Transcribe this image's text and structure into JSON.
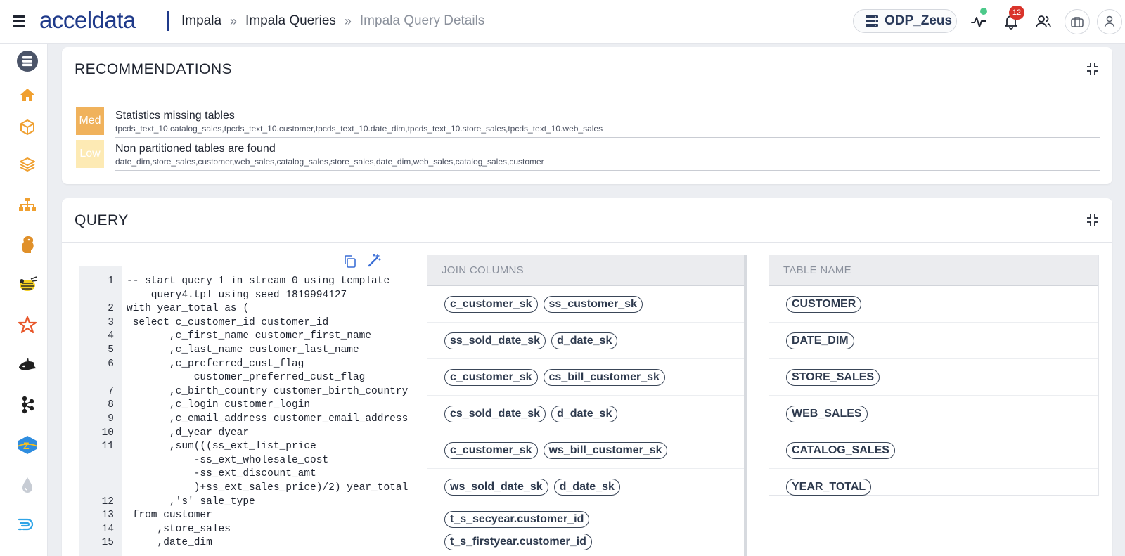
{
  "header": {
    "logo_text": "acceldata",
    "breadcrumb": [
      "Impala",
      "Impala Queries",
      "Impala Query Details"
    ],
    "breadcrumb_sep": "»",
    "cluster_name": "ODP_Zeus",
    "notification_count": "12"
  },
  "sidebar": {
    "items": [
      "database-icon",
      "home-icon",
      "cube-icon",
      "layers-icon",
      "hierarchy-icon",
      "hadoop-icon",
      "hive-icon",
      "spark-icon",
      "orca-icon",
      "kafka-icon",
      "zeppelin-icon",
      "drop-icon",
      "druid-icon"
    ]
  },
  "recommendations": {
    "title": "RECOMMENDATIONS",
    "items": [
      {
        "severity": "Med",
        "title": "Statistics missing tables",
        "detail": "tpcds_text_10.catalog_sales,tpcds_text_10.customer,tpcds_text_10.date_dim,tpcds_text_10.store_sales,tpcds_text_10.web_sales"
      },
      {
        "severity": "Low",
        "title": "Non partitioned tables are found",
        "detail": "date_dim,store_sales,customer,web_sales,catalog_sales,store_sales,date_dim,web_sales,catalog_sales,customer"
      }
    ]
  },
  "query": {
    "title": "QUERY",
    "code_lines": [
      {
        "n": "1",
        "text": "-- start query 1 in stream 0 using template"
      },
      {
        "n": "",
        "text": "    query4.tpl using seed 1819994127"
      },
      {
        "n": "2",
        "text": "with year_total as ("
      },
      {
        "n": "3",
        "text": " select c_customer_id customer_id"
      },
      {
        "n": "4",
        "text": "       ,c_first_name customer_first_name"
      },
      {
        "n": "5",
        "text": "       ,c_last_name customer_last_name"
      },
      {
        "n": "6",
        "text": "       ,c_preferred_cust_flag"
      },
      {
        "n": "",
        "text": "           customer_preferred_cust_flag"
      },
      {
        "n": "7",
        "text": "       ,c_birth_country customer_birth_country"
      },
      {
        "n": "8",
        "text": "       ,c_login customer_login"
      },
      {
        "n": "9",
        "text": "       ,c_email_address customer_email_address"
      },
      {
        "n": "10",
        "text": "       ,d_year dyear"
      },
      {
        "n": "11",
        "text": "       ,sum(((ss_ext_list_price"
      },
      {
        "n": "",
        "text": "           -ss_ext_wholesale_cost"
      },
      {
        "n": "",
        "text": "           -ss_ext_discount_amt"
      },
      {
        "n": "",
        "text": "           )+ss_ext_sales_price)/2) year_total"
      },
      {
        "n": "12",
        "text": "       ,'s' sale_type"
      },
      {
        "n": "13",
        "text": " from customer"
      },
      {
        "n": "14",
        "text": "     ,store_sales"
      },
      {
        "n": "15",
        "text": "     ,date_dim"
      }
    ],
    "join_columns": {
      "header": "JOIN COLUMNS",
      "rows": [
        [
          "c_customer_sk",
          "ss_customer_sk"
        ],
        [
          "ss_sold_date_sk",
          "d_date_sk"
        ],
        [
          "c_customer_sk",
          "cs_bill_customer_sk"
        ],
        [
          "cs_sold_date_sk",
          "d_date_sk"
        ],
        [
          "c_customer_sk",
          "ws_bill_customer_sk"
        ],
        [
          "ws_sold_date_sk",
          "d_date_sk"
        ],
        [
          "t_s_secyear.customer_id"
        ],
        [
          "t_s_firstyear.customer_id"
        ]
      ]
    },
    "table_names": {
      "header": "TABLE NAME",
      "rows": [
        "CUSTOMER",
        "DATE_DIM",
        "STORE_SALES",
        "WEB_SALES",
        "CATALOG_SALES",
        "YEAR_TOTAL"
      ]
    }
  }
}
